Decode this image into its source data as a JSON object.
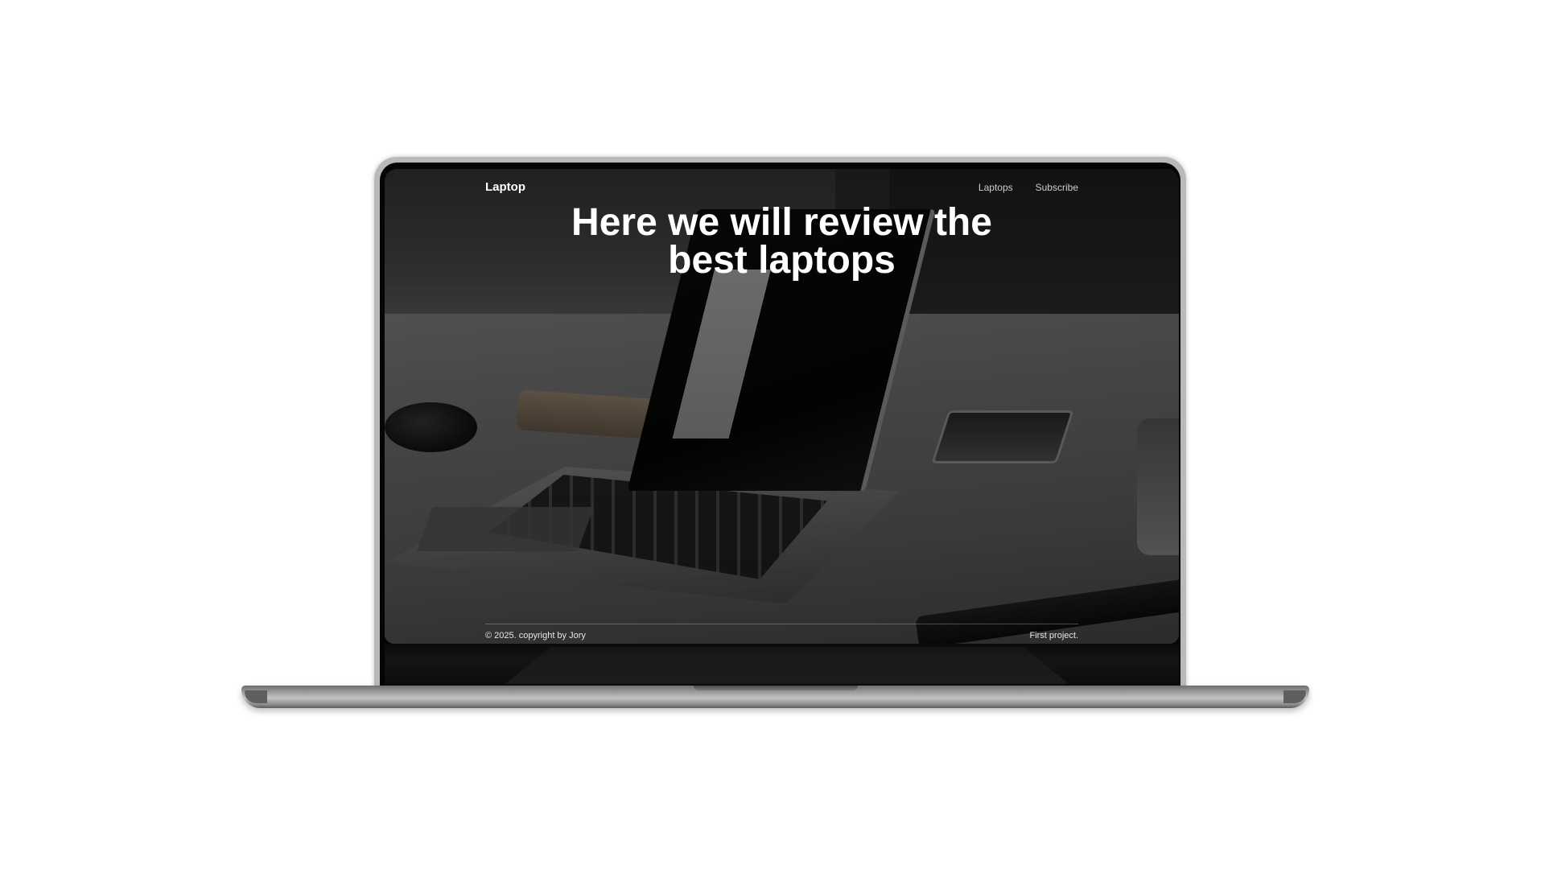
{
  "site": {
    "brand": "Laptop",
    "nav": [
      {
        "label": "Laptops"
      },
      {
        "label": "Subscribe"
      }
    ],
    "hero_title": "Here we will review the best laptops",
    "footer": {
      "copyright": "© 2025. copyright by Jory",
      "note": "First project."
    }
  },
  "colors": {
    "page_background": "#ffffff",
    "text": "#ffffff",
    "nav_link": "#cfcfcf",
    "overlay": "rgba(0,0,0,0.42)",
    "device_frame": "#b9b9b9"
  }
}
